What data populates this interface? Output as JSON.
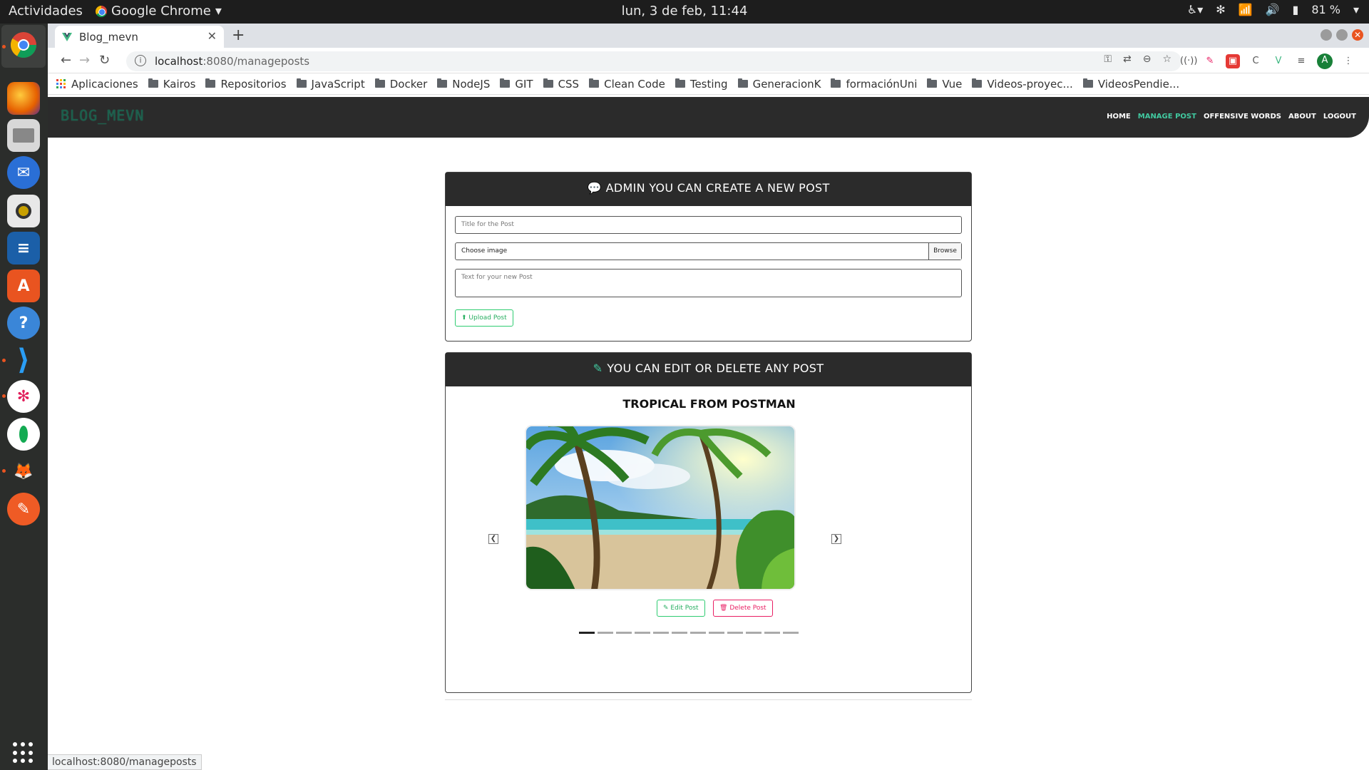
{
  "desktop": {
    "activities": "Actividades",
    "app_menu": "Google Chrome",
    "clock": "lun,  3 de feb, 11:44",
    "battery": "81 %"
  },
  "browser": {
    "tab_title": "Blog_mevn",
    "url_host": "localhost",
    "url_rest": ":8080/manageposts",
    "status_url": "localhost:8080/manageposts",
    "bookmarks": [
      "Aplicaciones",
      "Kairos",
      "Repositorios",
      "JavaScript",
      "Docker",
      "NodeJS",
      "GIT",
      "CSS",
      "Clean Code",
      "Testing",
      "GeneracionK",
      "formaciónUni",
      "Vue",
      "Videos-proyec...",
      "VideosPendie..."
    ],
    "avatar_letter": "A"
  },
  "app": {
    "brand": "BLOG_MEVN",
    "nav": [
      "HOME",
      "MANAGE POST",
      "OFFENSIVE WORDS",
      "ABOUT",
      "LOGOUT"
    ],
    "active_nav": "MANAGE POST",
    "accent": "#41c9a0"
  },
  "create": {
    "heading": "ADMIN YOU CAN CREATE A NEW POST",
    "title_placeholder": "Title for the Post",
    "file_label": "Choose image",
    "browse": "Browse",
    "text_placeholder": "Text for your new Post",
    "upload": "Upload Post"
  },
  "edit": {
    "heading": "YOU CAN EDIT OR DELETE ANY POST",
    "post_title": "TROPICAL FROM POSTMAN",
    "edit_btn": "Edit Post",
    "delete_btn": "Delete Post",
    "slides": 12,
    "active_slide": 1
  }
}
